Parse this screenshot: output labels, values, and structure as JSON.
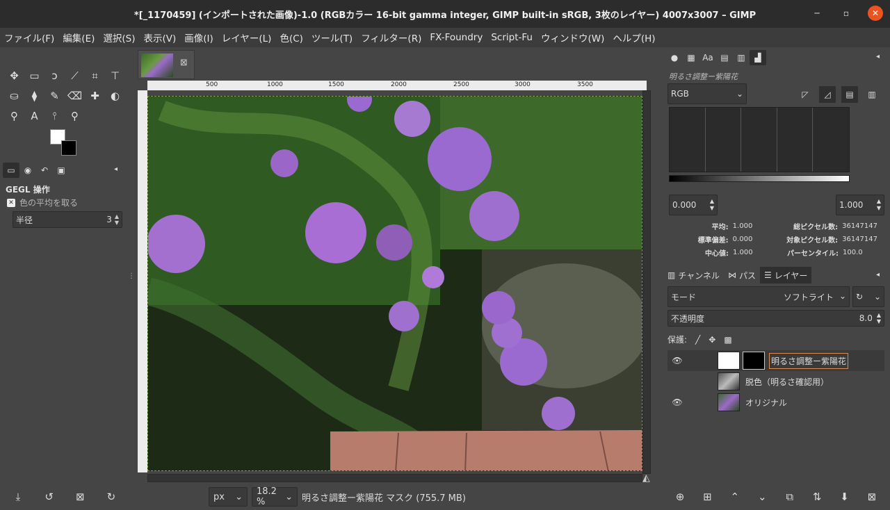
{
  "window": {
    "title": "*[_1170459] (インポートされた画像)-1.0 (RGBカラー 16-bit gamma integer, GIMP built-in sRGB, 3枚のレイヤー) 4007x3007 – GIMP",
    "min": "─",
    "max": "▫",
    "close": "✕"
  },
  "menu": [
    "ファイル(F)",
    "編集(E)",
    "選択(S)",
    "表示(V)",
    "画像(I)",
    "レイヤー(L)",
    "色(C)",
    "ツール(T)",
    "フィルター(R)",
    "FX-Foundry",
    "Script-Fu",
    "ウィンドウ(W)",
    "ヘルプ(H)"
  ],
  "tools": [
    {
      "name": "move-tool-icon",
      "glyph": "✥"
    },
    {
      "name": "rect-select-icon",
      "glyph": "▭"
    },
    {
      "name": "lasso-icon",
      "glyph": "ↄ"
    },
    {
      "name": "fuzzy-select-icon",
      "glyph": "⟋"
    },
    {
      "name": "crop-icon",
      "glyph": "⌗"
    },
    {
      "name": "transform-icon",
      "glyph": "⊤"
    },
    {
      "name": "bucket-fill-icon",
      "glyph": "⛀"
    },
    {
      "name": "paint-icon",
      "glyph": "⧫"
    },
    {
      "name": "brush-icon",
      "glyph": "✎"
    },
    {
      "name": "eraser-icon",
      "glyph": "⌫"
    },
    {
      "name": "heal-icon",
      "glyph": "✚"
    },
    {
      "name": "smudge-icon",
      "glyph": "◐"
    },
    {
      "name": "paths-icon",
      "glyph": "⚲"
    },
    {
      "name": "text-icon",
      "glyph": "A"
    },
    {
      "name": "color-picker-icon",
      "glyph": "⫯"
    },
    {
      "name": "zoom-icon",
      "glyph": "⚲"
    }
  ],
  "tool_options": {
    "section_title": "GEGL 操作",
    "operation": "色の平均を取る",
    "radius_label": "半径",
    "radius_value": "3"
  },
  "left_bottom_icons": [
    "⤓",
    "↺",
    "⊠",
    "↻"
  ],
  "canvas": {
    "ruler_ticks": [
      "500",
      "1000",
      "1500",
      "2000",
      "2500",
      "3000",
      "3500"
    ],
    "unit": "px",
    "zoom": "18.2 %",
    "status_text": "明るさ調整ー紫陽花 マスク (755.7 MB)"
  },
  "right": {
    "histogram_layer": "明るさ調整ー紫陽花",
    "channel": "RGB",
    "range_min": "0.000",
    "range_max": "1.000",
    "stats": [
      {
        "label": "平均:",
        "value": "1.000",
        "label2": "総ピクセル数:",
        "value2": "36147147"
      },
      {
        "label": "標準偏差:",
        "value": "0.000",
        "label2": "対象ピクセル数:",
        "value2": "36147147"
      },
      {
        "label": "中心値:",
        "value": "1.000",
        "label2": "パーセンタイル:",
        "value2": "100.0"
      }
    ],
    "tabs": {
      "channels": "チャンネル",
      "paths": "パス",
      "layers": "レイヤー"
    },
    "mode_label": "モード",
    "mode_value": "ソフトライト",
    "opacity_label": "不透明度",
    "opacity_value": "8.0",
    "lock_label": "保護:",
    "layers": [
      {
        "name": "明るさ調整ー紫陽花",
        "visible": true
      },
      {
        "name": "脱色（明るさ確認用）",
        "visible": false
      },
      {
        "name": "オリジナル",
        "visible": true
      }
    ],
    "bottom_icons": [
      "⊕",
      "⊞",
      "⌃",
      "⌄",
      "⧉",
      "⇅",
      "⬇",
      "⊠"
    ]
  }
}
